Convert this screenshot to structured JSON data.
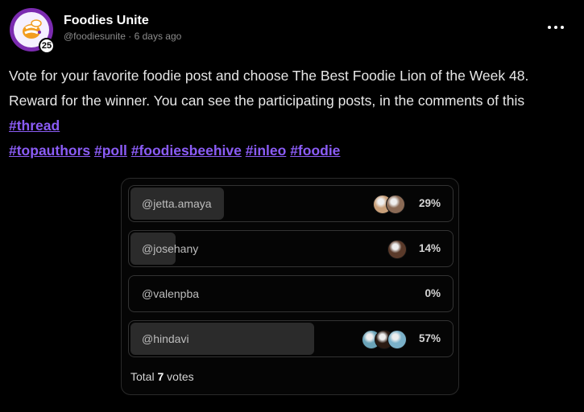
{
  "author": {
    "name": "Foodies Unite",
    "handle": "@foodiesunite",
    "separator": "·",
    "time": "6 days ago",
    "level": "25",
    "avatar_icon": "bee-logo-icon"
  },
  "post": {
    "text": "Vote for your favorite foodie post and choose The Best Foodie Lion of the Week 48. Reward for the winner. You can see the participating posts, in the comments of this ",
    "thread_tag": "#thread",
    "tags": [
      "#topauthors",
      "#poll",
      "#foodiesbeehive",
      "#inleo",
      "#foodie"
    ]
  },
  "poll": {
    "options": [
      {
        "label": "@jetta.amaya",
        "percent_text": "29%",
        "percent": 29,
        "voters": [
          "#c9a07a",
          "#8a6a55"
        ]
      },
      {
        "label": "@josehany",
        "percent_text": "14%",
        "percent": 14,
        "voters": [
          "#5a3a2a"
        ]
      },
      {
        "label": "@valenpba",
        "percent_text": "0%",
        "percent": 0,
        "voters": []
      },
      {
        "label": "@hindavi",
        "percent_text": "57%",
        "percent": 57,
        "voters": [
          "#6aa3b8",
          "#2a1a12",
          "#7ab0c8"
        ]
      }
    ],
    "total_prefix": "Total",
    "total_count": "7",
    "total_suffix": "votes"
  },
  "colors": {
    "accent": "#8b5cf6",
    "background": "#000000"
  }
}
